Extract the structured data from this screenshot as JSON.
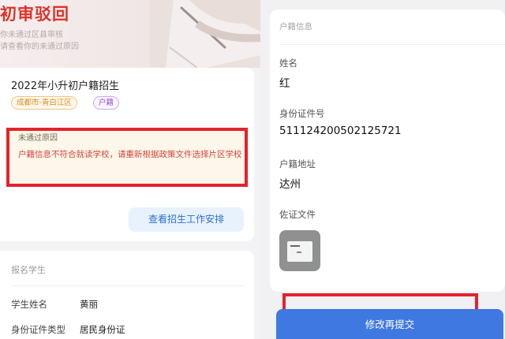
{
  "left": {
    "hero": {
      "title": "初审驳回",
      "line1": "你未通过区县审核",
      "line2": "请查看你的未通过原因"
    },
    "application": {
      "title": "2022年小升初户籍招生",
      "tags": [
        "成都市-青白江区",
        "户籍"
      ]
    },
    "reason": {
      "label": "未通过原因",
      "text": "户籍信息不符合就读学校，请重新根据政策文件选择片区学校"
    },
    "arrangement_button": "查看招生工作安排",
    "student": {
      "section_title": "报名学生",
      "rows": [
        {
          "label": "学生姓名",
          "value": "黄丽"
        },
        {
          "label": "身份证件类型",
          "value": "居民身份证"
        }
      ]
    }
  },
  "right": {
    "section_title": "户籍信息",
    "fields": [
      {
        "label": "姓名",
        "value": "红"
      },
      {
        "label": "身份证件号",
        "value": "511124200502125721"
      },
      {
        "label": "户籍地址",
        "value": "达州"
      }
    ],
    "proof_label": "佐证文件",
    "submit_button": "修改再提交"
  },
  "colors": {
    "alert_red": "#e3232b",
    "title_red": "#e0322a",
    "primary_blue": "#3f78e0",
    "link_blue": "#2f6fd0"
  }
}
